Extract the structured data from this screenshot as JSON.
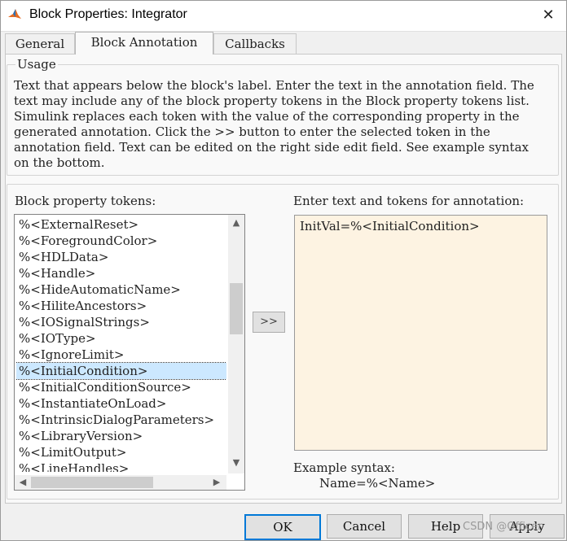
{
  "window": {
    "title": "Block Properties: Integrator",
    "close_glyph": "✕",
    "icon": "matlab-icon"
  },
  "tabs": [
    {
      "label": "General",
      "active": false
    },
    {
      "label": "Block Annotation",
      "active": true
    },
    {
      "label": "Callbacks",
      "active": false
    }
  ],
  "usage": {
    "legend": "Usage",
    "text": "Text that appears below the block's label. Enter the text in the annotation field. The text may include any of the block property tokens in the Block property tokens list. Simulink replaces each token with the value of the corresponding property in the generated annotation. Click the >> button to enter the selected token in the annotation field. Text can be edited on the right side edit field. See example syntax on the bottom."
  },
  "tokens": {
    "label": "Block property tokens:",
    "items": [
      "%<ExternalReset>",
      "%<ForegroundColor>",
      "%<HDLData>",
      "%<Handle>",
      "%<HideAutomaticName>",
      "%<HiliteAncestors>",
      "%<IOSignalStrings>",
      "%<IOType>",
      "%<IgnoreLimit>",
      "%<InitialCondition>",
      "%<InitialConditionSource>",
      "%<InstantiateOnLoad>",
      "%<IntrinsicDialogParameters>",
      "%<LibraryVersion>",
      "%<LimitOutput>",
      "%<LineHandles>"
    ],
    "selected": "%<InitialCondition>",
    "scroll_up_icon": "▲",
    "scroll_down_icon": "▼",
    "scroll_left_icon": "◀",
    "scroll_right_icon": "▶"
  },
  "add_button": {
    "label": ">>"
  },
  "annotation": {
    "label": "Enter text and tokens for annotation:",
    "value": "InitVal=%<InitialCondition>"
  },
  "example": {
    "label": "Example syntax:",
    "value": "Name=%<Name>"
  },
  "buttons": {
    "ok": "OK",
    "cancel": "Cancel",
    "help": "Help",
    "apply": "Apply"
  },
  "watermark": "CSDN @Officer"
}
